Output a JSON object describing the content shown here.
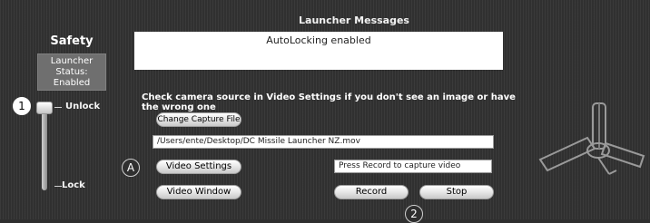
{
  "header": {
    "title": "Launcher Messages"
  },
  "safety": {
    "title": "Safety",
    "status_lines": [
      "Launcher",
      "Status:",
      "Enabled"
    ],
    "slider": {
      "top_label": "Unlock",
      "bottom_label": "Lock",
      "badge": "1"
    }
  },
  "messages": {
    "text": "AutoLocking enabled"
  },
  "hint": "Check camera source in Video Settings if you don't see an image or have the wrong one",
  "controls": {
    "change_capture_label": "Change Capture File",
    "capture_path": "/Users/ente/Desktop/DC Missile Launcher NZ.mov",
    "video_settings_label": "Video Settings",
    "video_settings_badge": "A",
    "status_field": "Press Record to capture video",
    "video_window_label": "Video Window",
    "record_label": "Record",
    "stop_label": "Stop",
    "record_badge": "2"
  },
  "icons": {
    "launcher": "missile-launcher-icon"
  }
}
